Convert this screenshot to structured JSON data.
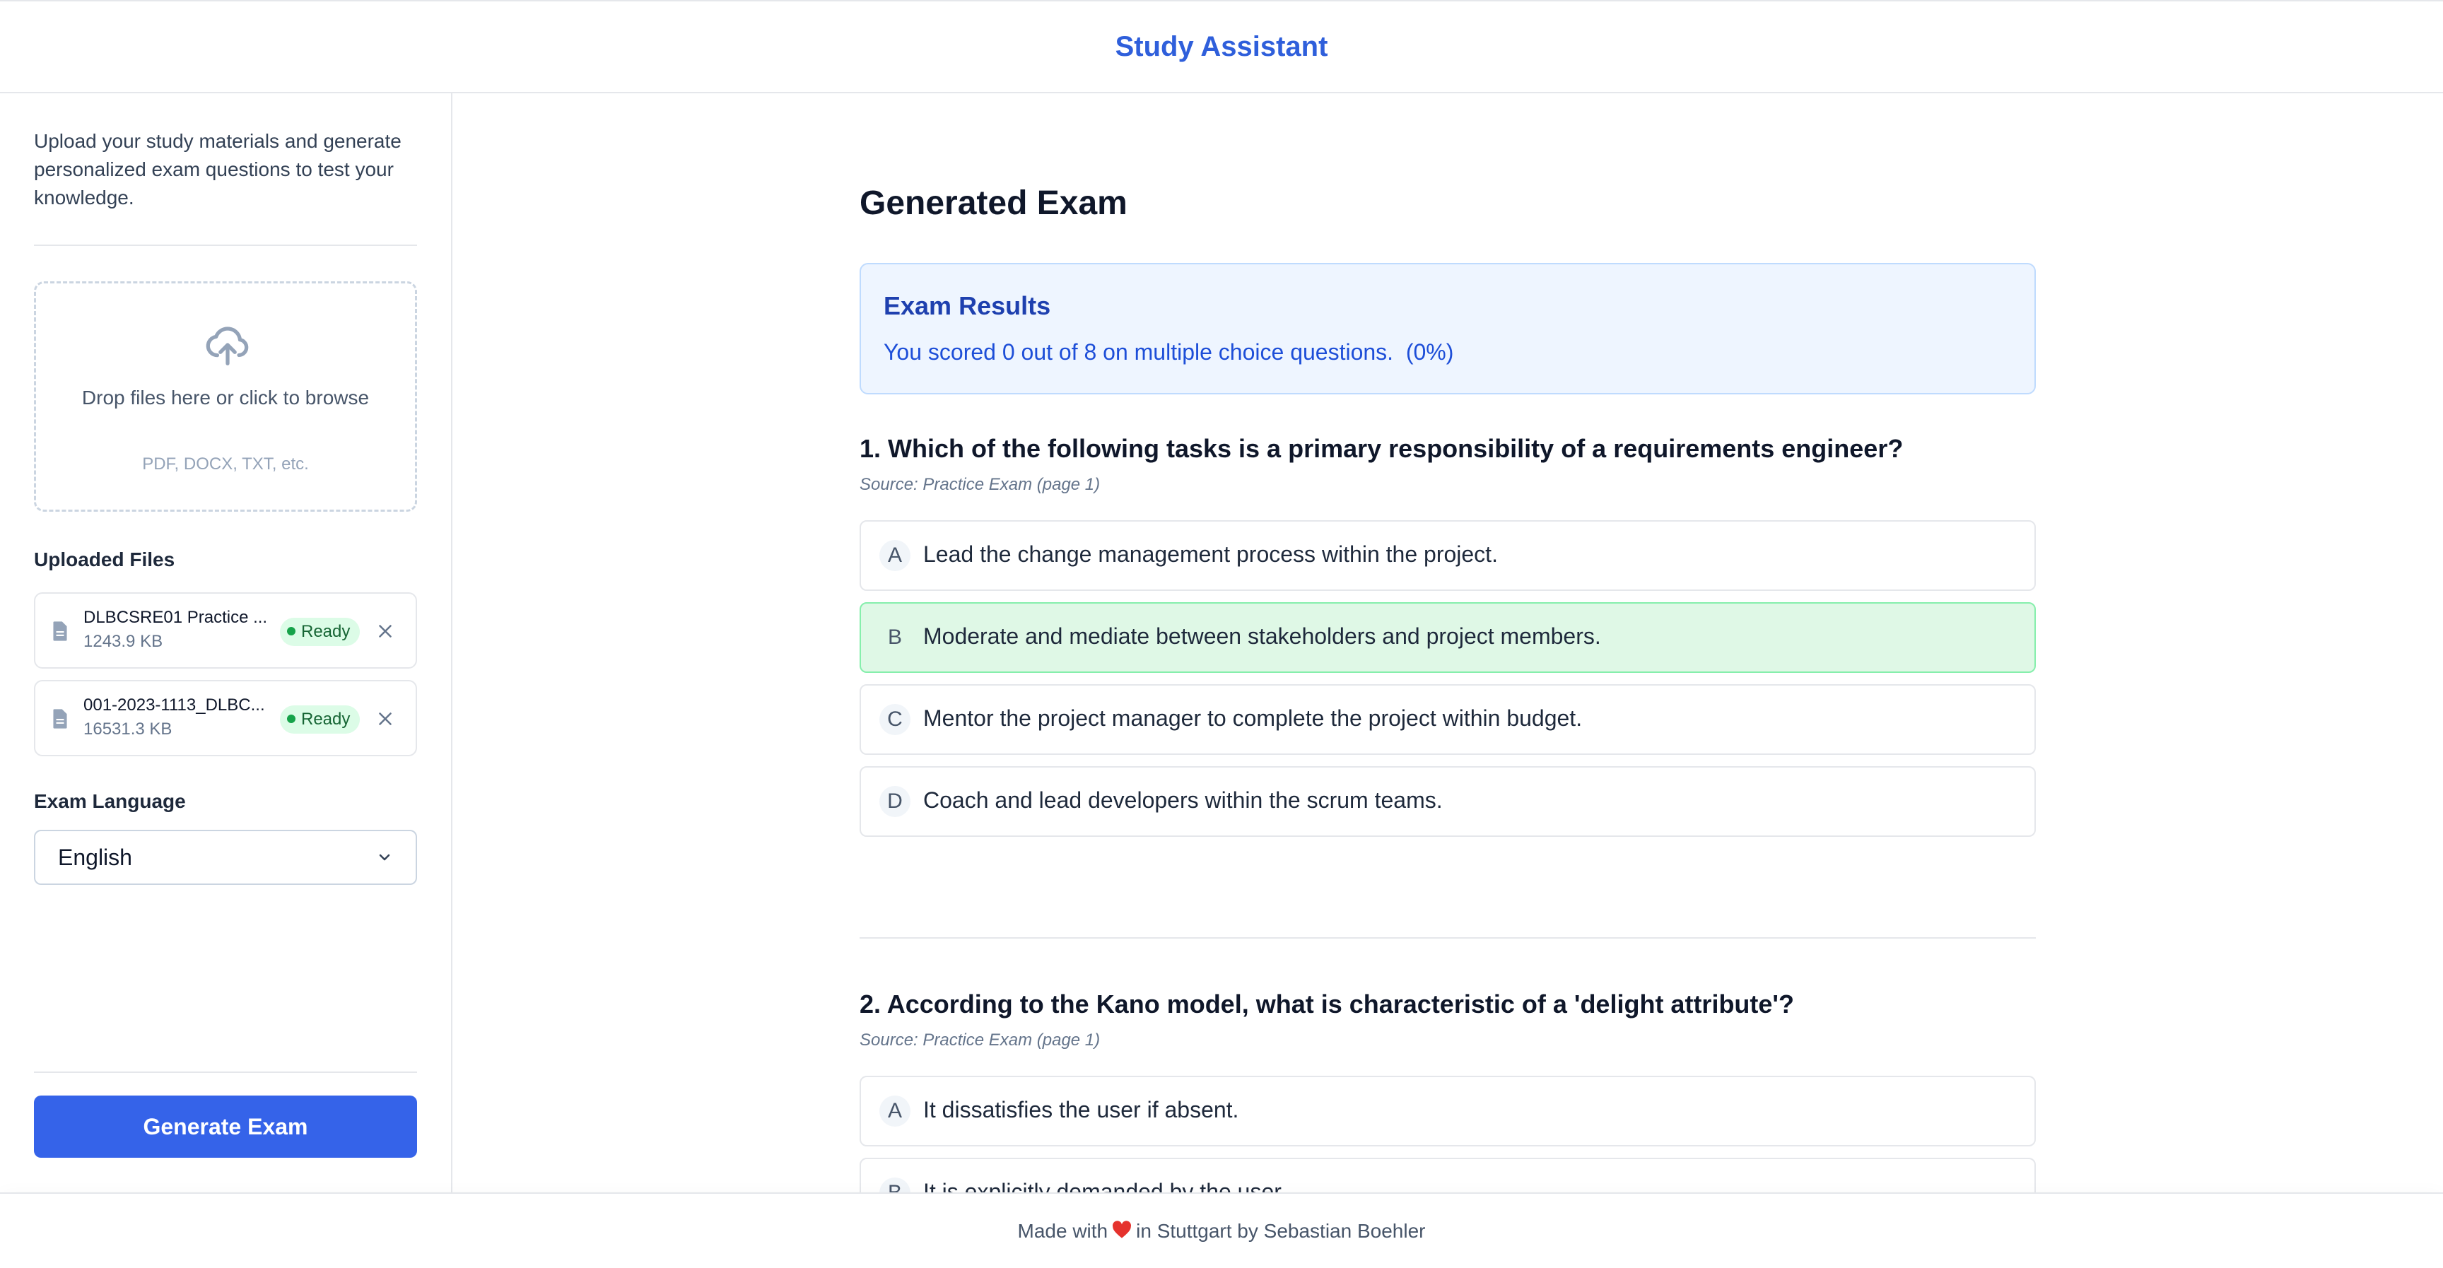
{
  "header": {
    "title": "Study Assistant"
  },
  "sidebar": {
    "intro": "Upload your study materials and generate personalized exam questions to test your knowledge.",
    "dropzone": {
      "text": "Drop files here or click to browse",
      "hint": "PDF, DOCX, TXT, etc."
    },
    "uploaded_label": "Uploaded Files",
    "files": [
      {
        "name": "DLBCSRE01 Practice ...",
        "size": "1243.9 KB",
        "status": "Ready"
      },
      {
        "name": "001-2023-1113_DLBC...",
        "size": "16531.3 KB",
        "status": "Ready"
      }
    ],
    "language_label": "Exam Language",
    "language_value": "English",
    "generate_label": "Generate Exam"
  },
  "main": {
    "title": "Generated Exam",
    "results": {
      "title": "Exam Results",
      "text": "You scored 0 out of 8 on multiple choice questions.  (0%)"
    },
    "questions": [
      {
        "text": "1. Which of the following tasks is a primary responsibility of a requirements engineer?",
        "source": "Source: Practice Exam (page 1)",
        "options": [
          {
            "letter": "A",
            "text": "Lead the change management process within the project."
          },
          {
            "letter": "B",
            "text": "Moderate and mediate between stakeholders and project members."
          },
          {
            "letter": "C",
            "text": "Mentor the project manager to complete the project within budget."
          },
          {
            "letter": "D",
            "text": "Coach and lead developers within the scrum teams."
          }
        ]
      },
      {
        "text": "2. According to the Kano model, what is characteristic of a 'delight attribute'?",
        "source": "Source: Practice Exam (page 1)",
        "options": [
          {
            "letter": "A",
            "text": "It dissatisfies the user if absent."
          },
          {
            "letter": "B",
            "text": "It is explicitly demanded by the user."
          }
        ]
      }
    ]
  },
  "footer": {
    "prefix": "Made with",
    "suffix": "in Stuttgart by Sebastian Boehler"
  },
  "colors": {
    "accent": "#3563e9",
    "title": "#2f5fdb",
    "correct_bg": "#dff8e6",
    "results_bg": "#eef5ff"
  }
}
